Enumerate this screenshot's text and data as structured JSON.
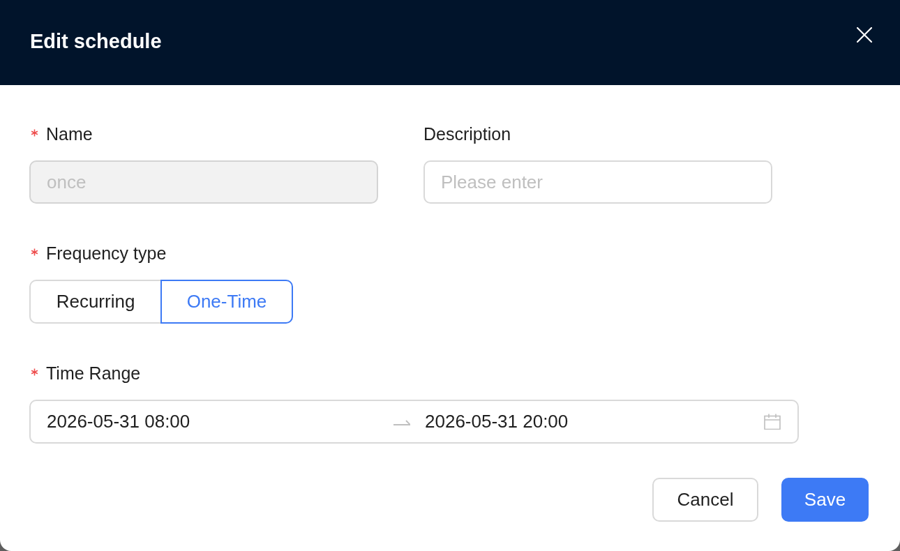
{
  "dialog": {
    "title": "Edit schedule"
  },
  "rows": [
    [
      {
        "kind": "text",
        "label": "Name",
        "required": true,
        "value": "once",
        "disabled": true
      },
      {
        "kind": "text",
        "label": "Description",
        "required": false,
        "placeholder": "Please enter",
        "disabled": false
      }
    ],
    [
      {
        "kind": "segmented",
        "label": "Frequency type",
        "required": true,
        "options": [
          {
            "label": "Recurring",
            "selected": false
          },
          {
            "label": "One-Time",
            "selected": true
          }
        ]
      }
    ],
    [
      {
        "kind": "date_range",
        "label": "Time Range",
        "required": true,
        "start": "2026-05-31 08:00",
        "end": "2026-05-31 20:00"
      }
    ]
  ],
  "buttons": [
    {
      "label": "Cancel",
      "kind": "default"
    },
    {
      "label": "Save",
      "kind": "primary"
    }
  ]
}
